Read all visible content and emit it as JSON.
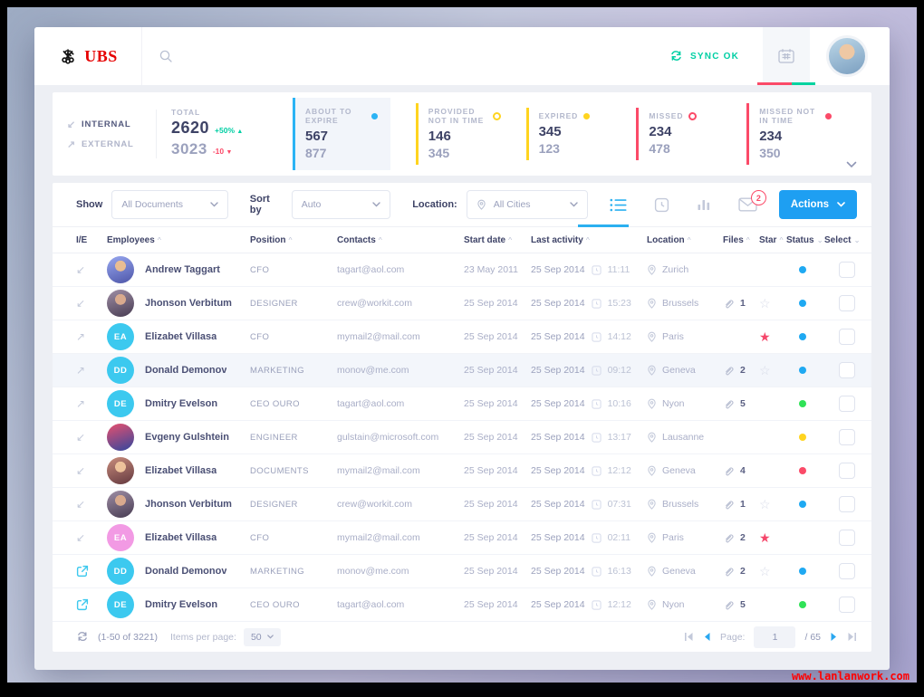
{
  "header": {
    "brand": "UBS",
    "sync_label": "SYNC OK"
  },
  "theme": {
    "accent_blue": "#1e9ff2",
    "teal": "#00cfa4",
    "red_pink": "#fb4a68",
    "yellow": "#ffd41f",
    "green": "#30e257",
    "brand_red": "#e60000"
  },
  "stats": {
    "internal_label": "INTERNAL",
    "external_label": "EXTERNAL",
    "total": {
      "label": "TOTAL",
      "value1": "2620",
      "delta1": "+50%",
      "value2": "3023",
      "delta2": "-10"
    },
    "cards": [
      {
        "label": "ABOUT TO EXPIRE",
        "value1": "567",
        "value2": "877",
        "color": "#2bb3f4",
        "dot": "filled",
        "active": true
      },
      {
        "label": "PROVIDED NOT IN TIME",
        "value1": "146",
        "value2": "345",
        "color": "#ffd41f",
        "dot": "outline",
        "active": false
      },
      {
        "label": "EXPIRED",
        "value1": "345",
        "value2": "123",
        "color": "#ffd41f",
        "dot": "filled",
        "active": false
      },
      {
        "label": "MISSED",
        "value1": "234",
        "value2": "478",
        "color": "#fb4a68",
        "dot": "outline",
        "active": false
      },
      {
        "label": "MISSED NOT IN TIME",
        "value1": "234",
        "value2": "350",
        "color": "#fb4a68",
        "dot": "filled",
        "active": false
      }
    ]
  },
  "filters": {
    "show_label": "Show",
    "show_value": "All Documents",
    "sort_label": "Sort by",
    "sort_value": "Auto",
    "location_label": "Location:",
    "location_value": "All Cities",
    "mail_badge": "2",
    "actions_label": "Actions"
  },
  "table": {
    "columns": [
      {
        "label": "I/E",
        "caret": ""
      },
      {
        "label": "Employees",
        "caret": "^"
      },
      {
        "label": "Position",
        "caret": "^"
      },
      {
        "label": "Contacts",
        "caret": "^"
      },
      {
        "label": "Start date",
        "caret": "^"
      },
      {
        "label": "Last activity",
        "caret": "^"
      },
      {
        "label": "Location",
        "caret": "^"
      },
      {
        "label": "Files",
        "caret": "^"
      },
      {
        "label": "Star",
        "caret": "^"
      },
      {
        "label": "Status",
        "caret": "⌄"
      },
      {
        "label": "Select",
        "caret": "⌄"
      }
    ],
    "rows": [
      {
        "ie": "in",
        "avatar": {
          "kind": "photo",
          "c1": "#98a8f0",
          "c2": "#4d55a8",
          "skin": "#e9bd92"
        },
        "name": "Andrew Taggart",
        "position": "CFO",
        "email": "tagart@aol.com",
        "start": "23 May 2011",
        "adate": "25 Sep 2014",
        "atime": "11:11",
        "location": "Zurich",
        "files": "",
        "star": "none",
        "status": "blue",
        "highlighted": false
      },
      {
        "ie": "in",
        "avatar": {
          "kind": "photo",
          "c1": "#a08fa6",
          "c2": "#473c52",
          "skin": "#d9aa8e"
        },
        "name": "Jhonson Verbitum",
        "position": "DESIGNER",
        "email": "crew@workit.com",
        "start": "25 Sep 2014",
        "adate": "25 Sep 2014",
        "atime": "15:23",
        "location": "Brussels",
        "files": "1",
        "star": "outline",
        "status": "blue",
        "highlighted": false
      },
      {
        "ie": "ex",
        "avatar": {
          "kind": "init",
          "text": "EA",
          "color": "#3cc9ef"
        },
        "name": "Elizabet Villasa",
        "position": "CFO",
        "email": "mymail2@mail.com",
        "start": "25 Sep 2014",
        "adate": "25 Sep 2014",
        "atime": "14:12",
        "location": "Paris",
        "files": "",
        "star": "filled",
        "status": "blue",
        "highlighted": false
      },
      {
        "ie": "ex",
        "avatar": {
          "kind": "init",
          "text": "DD",
          "color": "#3cc9ef"
        },
        "name": "Donald Demonov",
        "position": "MARKETING",
        "email": "monov@me.com",
        "start": "25 Sep 2014",
        "adate": "25 Sep 2014",
        "atime": "09:12",
        "location": "Geneva",
        "files": "2",
        "star": "outline",
        "status": "blue",
        "highlighted": true
      },
      {
        "ie": "ex",
        "avatar": {
          "kind": "init",
          "text": "DE",
          "color": "#3cc9ef"
        },
        "name": "Dmitry Evelson",
        "position": "CEO OURO",
        "email": "tagart@aol.com",
        "start": "25 Sep 2014",
        "adate": "25 Sep 2014",
        "atime": "10:16",
        "location": "Nyon",
        "files": "5",
        "star": "none",
        "status": "green",
        "highlighted": false
      },
      {
        "ie": "in",
        "avatar": {
          "kind": "photo",
          "c1": "#e8506e",
          "c2": "#31479e"
        },
        "name": "Evgeny Gulshtein",
        "position": "ENGINEER",
        "email": "gulstain@microsoft.com",
        "start": "25 Sep 2014",
        "adate": "25 Sep 2014",
        "atime": "13:17",
        "location": "Lausanne",
        "files": "",
        "star": "none",
        "status": "yellow",
        "highlighted": false
      },
      {
        "ie": "in",
        "avatar": {
          "kind": "photo",
          "c1": "#c98d7c",
          "c2": "#63383f",
          "skin": "#edc29b"
        },
        "name": "Elizabet Villasa",
        "position": "DOCUMENTS",
        "email": "mymail2@mail.com",
        "start": "25 Sep 2014",
        "adate": "25 Sep 2014",
        "atime": "12:12",
        "location": "Geneva",
        "files": "4",
        "star": "none",
        "status": "red",
        "highlighted": false
      },
      {
        "ie": "in",
        "avatar": {
          "kind": "photo",
          "c1": "#a08fa6",
          "c2": "#473c52",
          "skin": "#d9aa8e"
        },
        "name": "Jhonson Verbitum",
        "position": "DESIGNER",
        "email": "crew@workit.com",
        "start": "25 Sep 2014",
        "adate": "25 Sep 2014",
        "atime": "07:31",
        "location": "Brussels",
        "files": "1",
        "star": "outline",
        "status": "blue",
        "highlighted": false
      },
      {
        "ie": "in",
        "avatar": {
          "kind": "init",
          "text": "EA",
          "color": "#f29ae4"
        },
        "name": "Elizabet Villasa",
        "position": "CFO",
        "email": "mymail2@mail.com",
        "start": "25 Sep 2014",
        "adate": "25 Sep 2014",
        "atime": "02:11",
        "location": "Paris",
        "files": "2",
        "star": "filled",
        "status": "",
        "highlighted": false
      },
      {
        "ie": "link",
        "avatar": {
          "kind": "init",
          "text": "DD",
          "color": "#3cc9ef"
        },
        "name": "Donald Demonov",
        "position": "MARKETING",
        "email": "monov@me.com",
        "start": "25 Sep 2014",
        "adate": "25 Sep 2014",
        "atime": "16:13",
        "location": "Geneva",
        "files": "2",
        "star": "outline",
        "status": "blue",
        "highlighted": false
      },
      {
        "ie": "link",
        "avatar": {
          "kind": "init",
          "text": "DE",
          "color": "#3cc9ef"
        },
        "name": "Dmitry Evelson",
        "position": "CEO OURO",
        "email": "tagart@aol.com",
        "start": "25 Sep 2014",
        "adate": "25 Sep 2014",
        "atime": "12:12",
        "location": "Nyon",
        "files": "5",
        "star": "none",
        "status": "green",
        "highlighted": false
      }
    ]
  },
  "footer": {
    "range": "(1-50 of 3221)",
    "items_label": "Items per page:",
    "per_page": "50",
    "page_label": "Page:",
    "page": "1",
    "pages_total": "/ 65"
  },
  "watermark": "www.lanlanwork.com"
}
